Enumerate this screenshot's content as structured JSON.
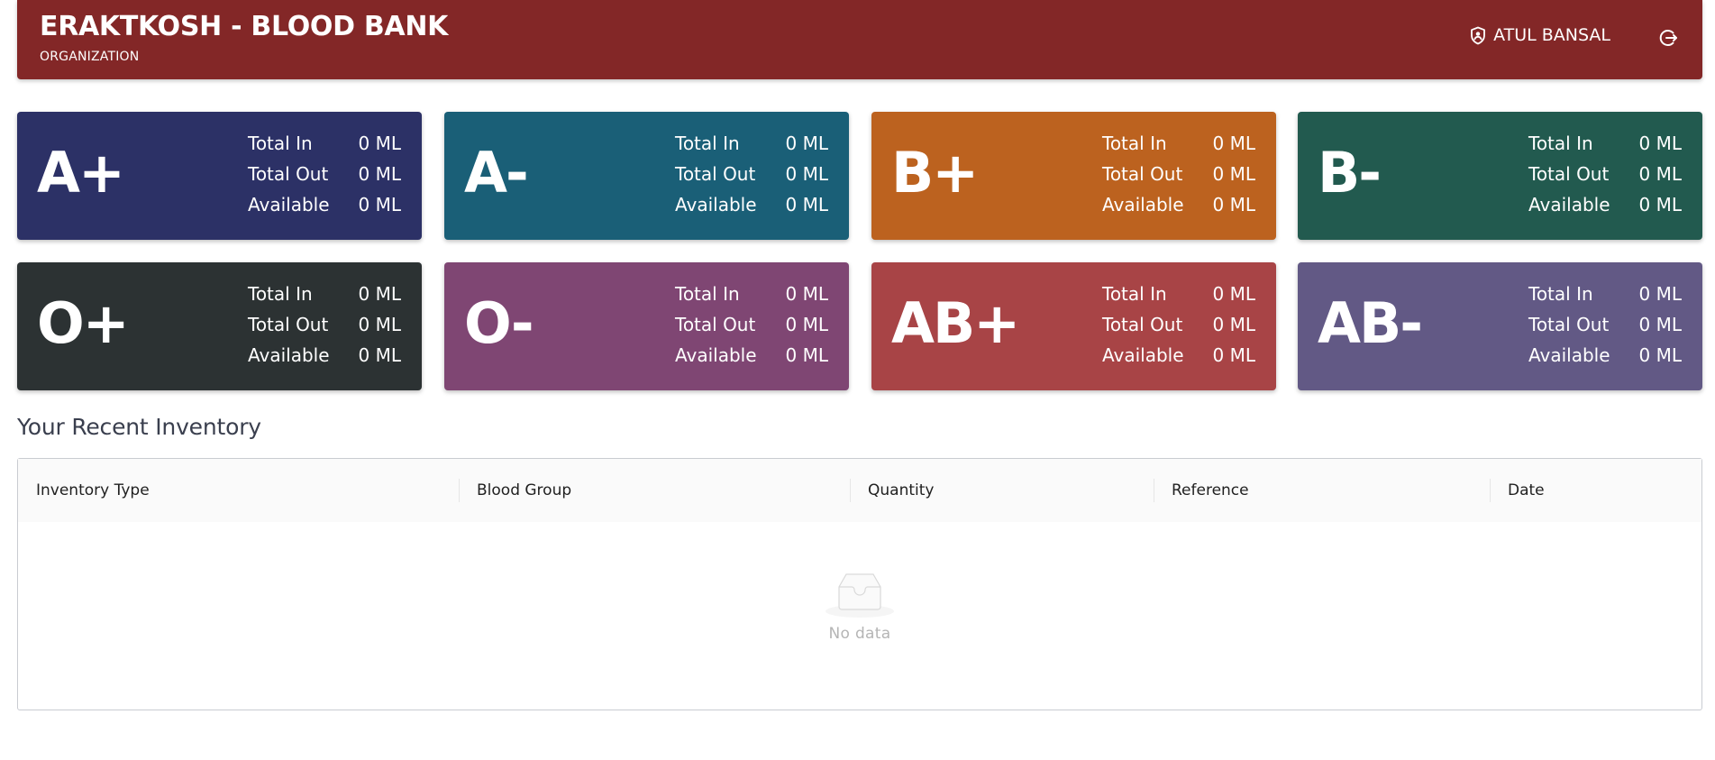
{
  "header": {
    "title": "ERAKTKOSH - BLOOD BANK",
    "subtitle": "ORGANIZATION",
    "user_name": "ATUL BANSAL",
    "user_icon": "shield-user-icon",
    "logout_icon": "logout-icon",
    "background_color": "#832727"
  },
  "blood_groups": [
    {
      "group": "A+",
      "color": "#2c3166",
      "total_in_label": "Total In",
      "total_in": "0 ML",
      "total_out_label": "Total Out",
      "total_out": "0 ML",
      "available_label": "Available",
      "available": "0 ML"
    },
    {
      "group": "A-",
      "color": "#1a5f77",
      "total_in_label": "Total In",
      "total_in": "0 ML",
      "total_out_label": "Total Out",
      "total_out": "0 ML",
      "available_label": "Available",
      "available": "0 ML"
    },
    {
      "group": "B+",
      "color": "#bc621f",
      "total_in_label": "Total In",
      "total_in": "0 ML",
      "total_out_label": "Total Out",
      "total_out": "0 ML",
      "available_label": "Available",
      "available": "0 ML"
    },
    {
      "group": "B-",
      "color": "#225a4f",
      "total_in_label": "Total In",
      "total_in": "0 ML",
      "total_out_label": "Total Out",
      "total_out": "0 ML",
      "available_label": "Available",
      "available": "0 ML"
    },
    {
      "group": "O+",
      "color": "#2c3233",
      "total_in_label": "Total In",
      "total_in": "0 ML",
      "total_out_label": "Total Out",
      "total_out": "0 ML",
      "available_label": "Available",
      "available": "0 ML"
    },
    {
      "group": "O-",
      "color": "#7f4673",
      "total_in_label": "Total In",
      "total_in": "0 ML",
      "total_out_label": "Total Out",
      "total_out": "0 ML",
      "available_label": "Available",
      "available": "0 ML"
    },
    {
      "group": "AB+",
      "color": "#a84446",
      "total_in_label": "Total In",
      "total_in": "0 ML",
      "total_out_label": "Total Out",
      "total_out": "0 ML",
      "available_label": "Available",
      "available": "0 ML"
    },
    {
      "group": "AB-",
      "color": "#625985",
      "total_in_label": "Total In",
      "total_in": "0 ML",
      "total_out_label": "Total Out",
      "total_out": "0 ML",
      "available_label": "Available",
      "available": "0 ML"
    }
  ],
  "inventory": {
    "title": "Your Recent Inventory",
    "columns": [
      "Inventory Type",
      "Blood Group",
      "Quantity",
      "Reference",
      "Date"
    ],
    "rows": [],
    "empty_icon": "inbox-icon",
    "empty_text": "No data"
  }
}
